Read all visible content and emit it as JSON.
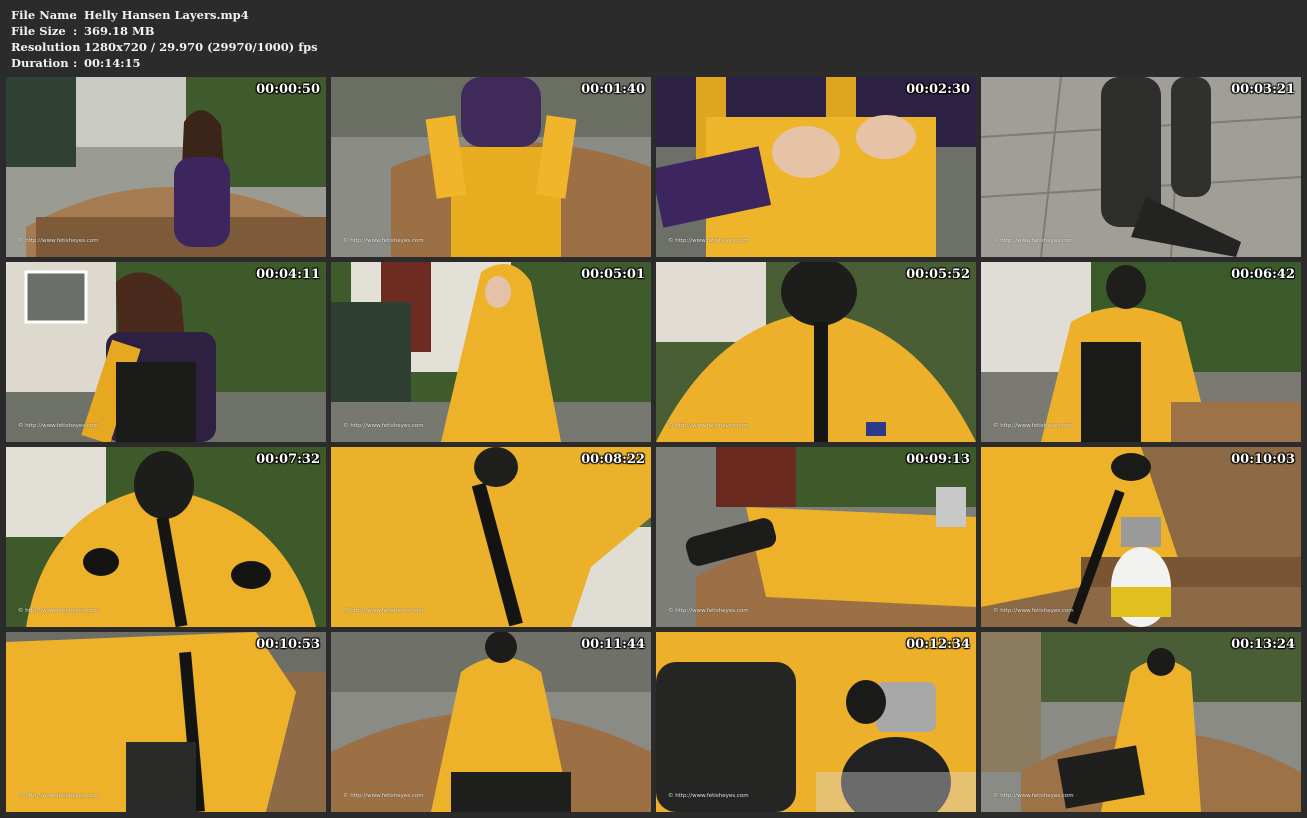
{
  "file_info": {
    "name_label": "File Name",
    "name_value": "Helly Hansen Layers.mp4",
    "size_label": "File Size",
    "size_value": "369.18 MB",
    "resolution_label": "Resolution",
    "resolution_value": "1280x720 / 29.970 (29970/1000) fps",
    "duration_label": "Duration",
    "duration_value": "00:14:15",
    "separator": ":"
  },
  "watermark_text": "© http://www.fetisheyes.com",
  "thumbnails": [
    {
      "time": "00:00:50",
      "scene": "garden-bench-purple"
    },
    {
      "time": "00:01:40",
      "scene": "yellow-trousers-bench"
    },
    {
      "time": "00:02:30",
      "scene": "yellow-closeup-hands"
    },
    {
      "time": "00:03:21",
      "scene": "boots-patio"
    },
    {
      "time": "00:04:11",
      "scene": "bib-garden"
    },
    {
      "time": "00:05:01",
      "scene": "yellow-coat-house"
    },
    {
      "time": "00:05:52",
      "scene": "gasmask-closeup"
    },
    {
      "time": "00:06:42",
      "scene": "gasmask-garden"
    },
    {
      "time": "00:07:32",
      "scene": "gasmask-gloves"
    },
    {
      "time": "00:08:22",
      "scene": "yellow-arms-raised"
    },
    {
      "time": "00:09:13",
      "scene": "reclining-bench"
    },
    {
      "time": "00:10:03",
      "scene": "tank-bench"
    },
    {
      "time": "00:10:53",
      "scene": "seated-coat"
    },
    {
      "time": "00:11:44",
      "scene": "seated-bench-wide"
    },
    {
      "time": "00:12:34",
      "scene": "tank-closeup"
    },
    {
      "time": "00:13:24",
      "scene": "bench-wide-end"
    }
  ]
}
